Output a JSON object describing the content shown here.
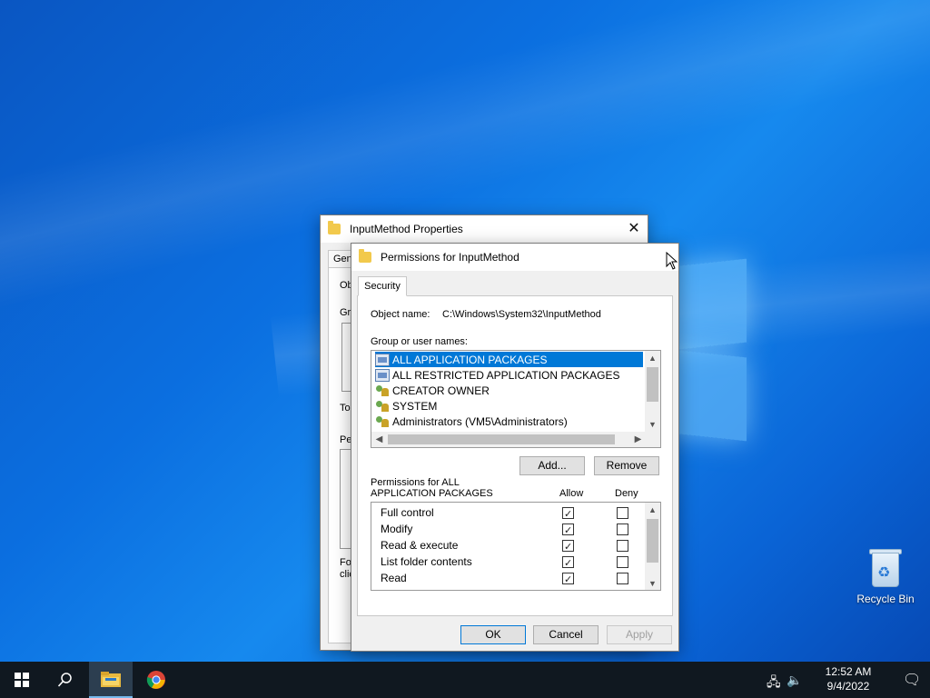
{
  "desktop": {
    "recycle_bin_label": "Recycle Bin"
  },
  "properties_dialog": {
    "title": "InputMethod Properties",
    "tab_fragment": "Gen",
    "fragments": [
      "Ob",
      "Gr",
      "To",
      "Pe",
      "Fo",
      "clic"
    ]
  },
  "permissions_dialog": {
    "title": "Permissions for InputMethod",
    "tab_security": "Security",
    "object_name_label": "Object name:",
    "object_name_value": "C:\\Windows\\System32\\InputMethod",
    "group_label": "Group or user names:",
    "groups": [
      {
        "name": "ALL APPLICATION PACKAGES",
        "icon": "package-icon",
        "selected": true
      },
      {
        "name": "ALL RESTRICTED APPLICATION PACKAGES",
        "icon": "package-icon",
        "selected": false
      },
      {
        "name": "CREATOR OWNER",
        "icon": "users-icon",
        "selected": false
      },
      {
        "name": "SYSTEM",
        "icon": "users-icon",
        "selected": false
      },
      {
        "name": "Administrators (VM5\\Administrators)",
        "icon": "users-icon",
        "selected": false
      }
    ],
    "add_button": "Add...",
    "remove_button": "Remove",
    "perms_for_label_1": "Permissions for ALL",
    "perms_for_label_2": "APPLICATION PACKAGES",
    "allow_header": "Allow",
    "deny_header": "Deny",
    "permissions": [
      {
        "name": "Full control",
        "allow": true,
        "deny": false
      },
      {
        "name": "Modify",
        "allow": true,
        "deny": false
      },
      {
        "name": "Read & execute",
        "allow": true,
        "deny": false
      },
      {
        "name": "List folder contents",
        "allow": true,
        "deny": false
      },
      {
        "name": "Read",
        "allow": true,
        "deny": false
      }
    ],
    "ok_button": "OK",
    "cancel_button": "Cancel",
    "apply_button": "Apply"
  },
  "taskbar": {
    "time": "12:52 AM",
    "date": "9/4/2022"
  }
}
